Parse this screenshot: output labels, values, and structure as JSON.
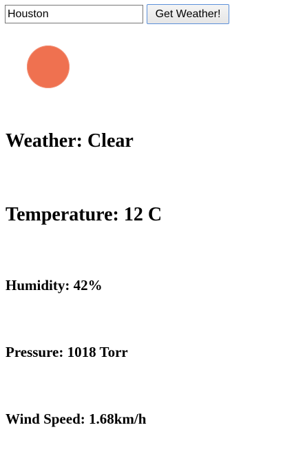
{
  "search": {
    "value": "Houston",
    "button_label": "Get Weather!"
  },
  "icon": {
    "name": "sun-icon",
    "color": "#ef7150"
  },
  "weather": {
    "label": "Weather: Clear"
  },
  "temperature": {
    "label": "Temperature: 12 C"
  },
  "humidity": {
    "label": "Humidity: 42%"
  },
  "pressure": {
    "label": "Pressure: 1018 Torr"
  },
  "wind": {
    "label": "Wind Speed: 1.68km/h"
  }
}
